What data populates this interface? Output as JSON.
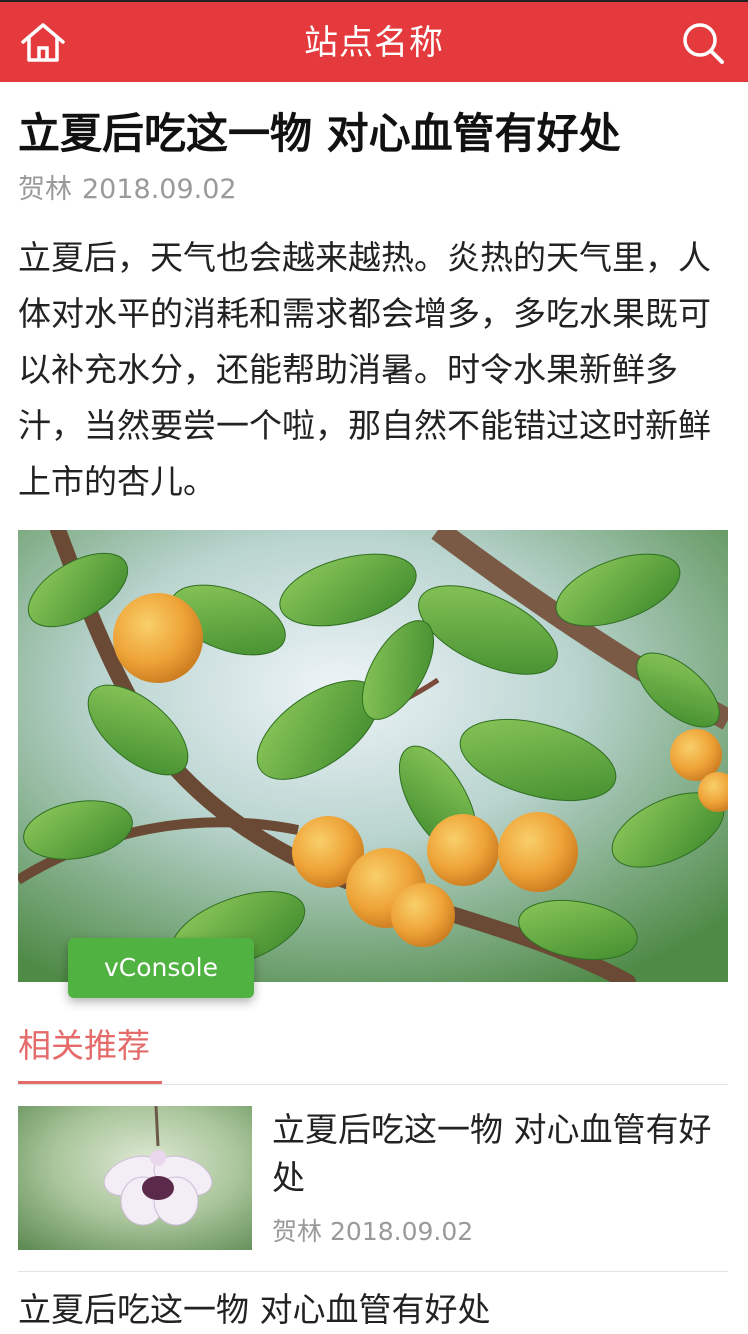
{
  "header": {
    "site_title": "站点名称",
    "home_icon": "home-icon",
    "search_icon": "search-icon",
    "bg_color": "#e43a3d"
  },
  "article": {
    "title": "立夏后吃这一物 对心血管有好处",
    "author": "贺林",
    "date": "2018.09.02",
    "body": "立夏后，天气也会越来越热。炎热的天气里，人体对水平的消耗和需求都会增多，多吃水果既可以补充水分，还能帮助消暑。时令水果新鲜多汁，当然要尝一个啦，那自然不能错过这时新鲜上市的杏儿。"
  },
  "vconsole": {
    "label": "vConsole",
    "color": "#4fb241"
  },
  "related": {
    "heading": "相关推荐",
    "accent": "#e56b6b",
    "items": [
      {
        "title": "立夏后吃这一物 对心血管有好处",
        "author": "贺林",
        "date": "2018.09.02"
      },
      {
        "title": "立夏后吃这一物 对心血管有好处"
      }
    ]
  }
}
